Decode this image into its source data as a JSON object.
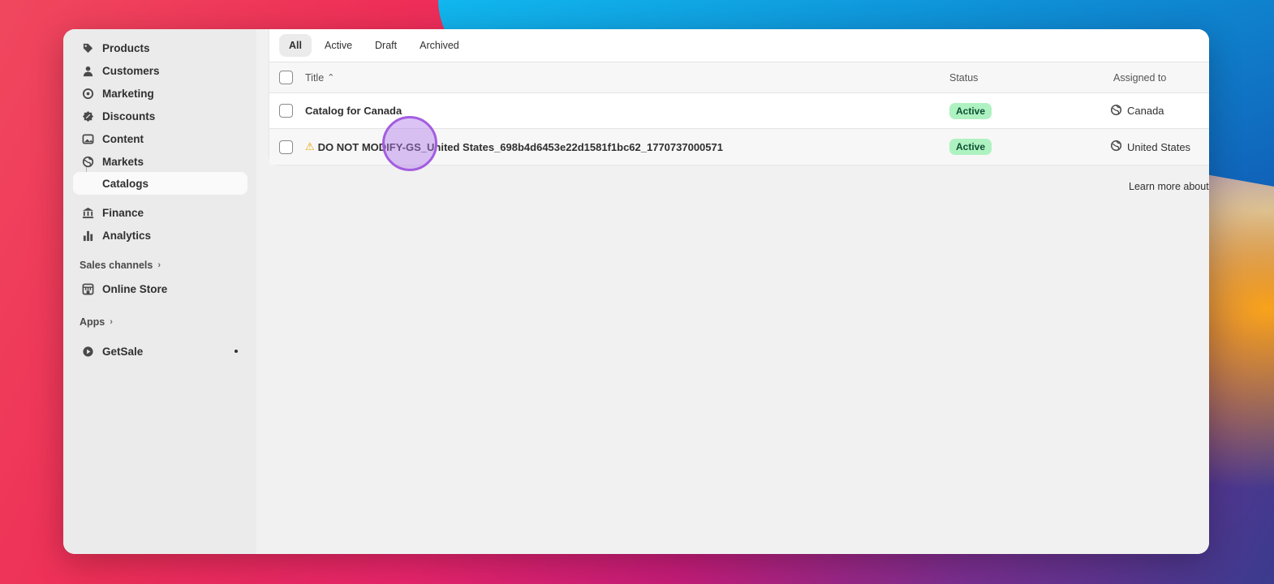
{
  "sidebar": {
    "items": [
      {
        "label": "Products",
        "icon": "tag-icon"
      },
      {
        "label": "Customers",
        "icon": "person-icon"
      },
      {
        "label": "Marketing",
        "icon": "target-icon"
      },
      {
        "label": "Discounts",
        "icon": "discount-icon"
      },
      {
        "label": "Content",
        "icon": "image-icon"
      },
      {
        "label": "Markets",
        "icon": "globe-icon"
      },
      {
        "label": "Catalogs",
        "icon": "sub-arrow-icon"
      },
      {
        "label": "Finance",
        "icon": "bank-icon"
      },
      {
        "label": "Analytics",
        "icon": "bar-chart-icon"
      }
    ],
    "sales_channels_label": "Sales channels",
    "online_store_label": "Online Store",
    "apps_label": "Apps",
    "getsale_label": "GetSale"
  },
  "tabs": [
    "All",
    "Active",
    "Draft",
    "Archived"
  ],
  "table": {
    "headers": {
      "title": "Title",
      "status": "Status",
      "assigned": "Assigned to"
    },
    "rows": [
      {
        "title": "Catalog for Canada",
        "status": "Active",
        "assigned": "Canada"
      },
      {
        "title": "DO NOT MODIFY-GS_United States_698b4d6453e22d1581f1bc62_1770737000571",
        "status": "Active",
        "assigned": "United States"
      }
    ]
  },
  "footer": {
    "learn_more": "Learn more about"
  },
  "colors": {
    "active_badge_bg": "#aff2c1",
    "active_badge_text": "#0c5132",
    "cursor": "#a35de0"
  }
}
